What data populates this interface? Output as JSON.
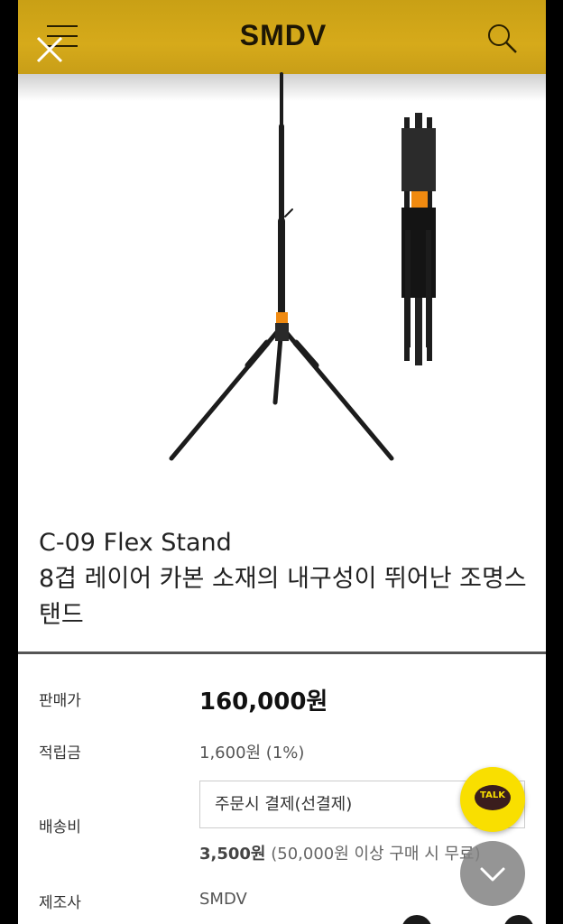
{
  "header": {
    "logo_text": "SMDV",
    "icons": [
      "menu-icon",
      "close-icon",
      "search-icon"
    ],
    "bg_color": "#d4a81a"
  },
  "product": {
    "title_line1": "C-09 Flex Stand",
    "title_line2": "8겹 레이어 카본 소재의 내구성이 뛰어난 조명스탠드"
  },
  "details": {
    "price_label": "판매가",
    "price_value": "160,000원",
    "points_label": "적립금",
    "points_value": "1,600원 (1%)",
    "shipping_label": "배송비",
    "shipping_select": "주문시 결제(선결제)",
    "shipping_fee": "3,500원",
    "shipping_condition": "(50,000원 이상 구매 시 무료)",
    "maker_label": "제조사",
    "maker_value": "SMDV"
  },
  "floating": {
    "talk_label": "TALK",
    "talk_color": "#f9df00",
    "scroll_icon": "chevron-down-icon"
  }
}
